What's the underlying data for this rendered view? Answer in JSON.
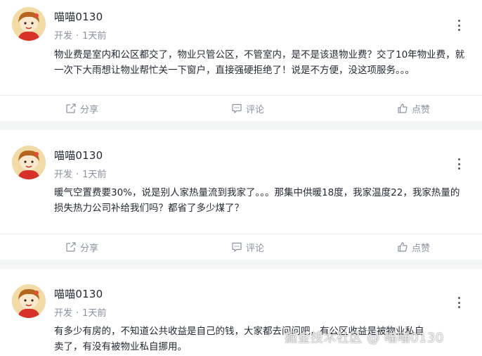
{
  "posts": [
    {
      "author": "喵喵0130",
      "topic": "开发",
      "time": "1天前",
      "content_lines": [
        "物业费是室内和公区都交了，物业只管公区，不管室内，是不是该退物业费？交了10年物业费，就",
        "一次下大雨想让物业帮忙关一下窗户，直接强硬拒绝了！说是不方便，没这项服务。。。"
      ],
      "actions": {
        "share": "分享",
        "comment": "评论",
        "like": "点赞"
      }
    },
    {
      "author": "喵喵0130",
      "topic": "开发",
      "time": "1天前",
      "content_lines": [
        "暖气空置费要30%，说是别人家热量流到我家了。。。那集中供暖18度，我家温度22，我家热量的",
        "损失热力公司补给我们吗？都省了多少煤了？"
      ],
      "actions": {
        "share": "分享",
        "comment": "评论",
        "like": "点赞"
      }
    },
    {
      "author": "喵喵0130",
      "topic": "开发",
      "time": "1天前",
      "content_lines": [
        "有多少有房的，不知道公共收益是自己的钱，大家都去问问吧，有公区收益是被物业私自",
        "卖了，有没有被物业私自挪用。"
      ]
    }
  ],
  "watermark": "掘金技术社区 @ 喵喵0130",
  "colors": {
    "text": "#252933",
    "muted": "#8a919f",
    "page_bg": "#f4f5f5",
    "card_bg": "#ffffff"
  },
  "icons": {
    "more": "more-vertical-icon",
    "share": "share-icon",
    "comment": "comment-icon",
    "like": "thumb-up-icon"
  }
}
